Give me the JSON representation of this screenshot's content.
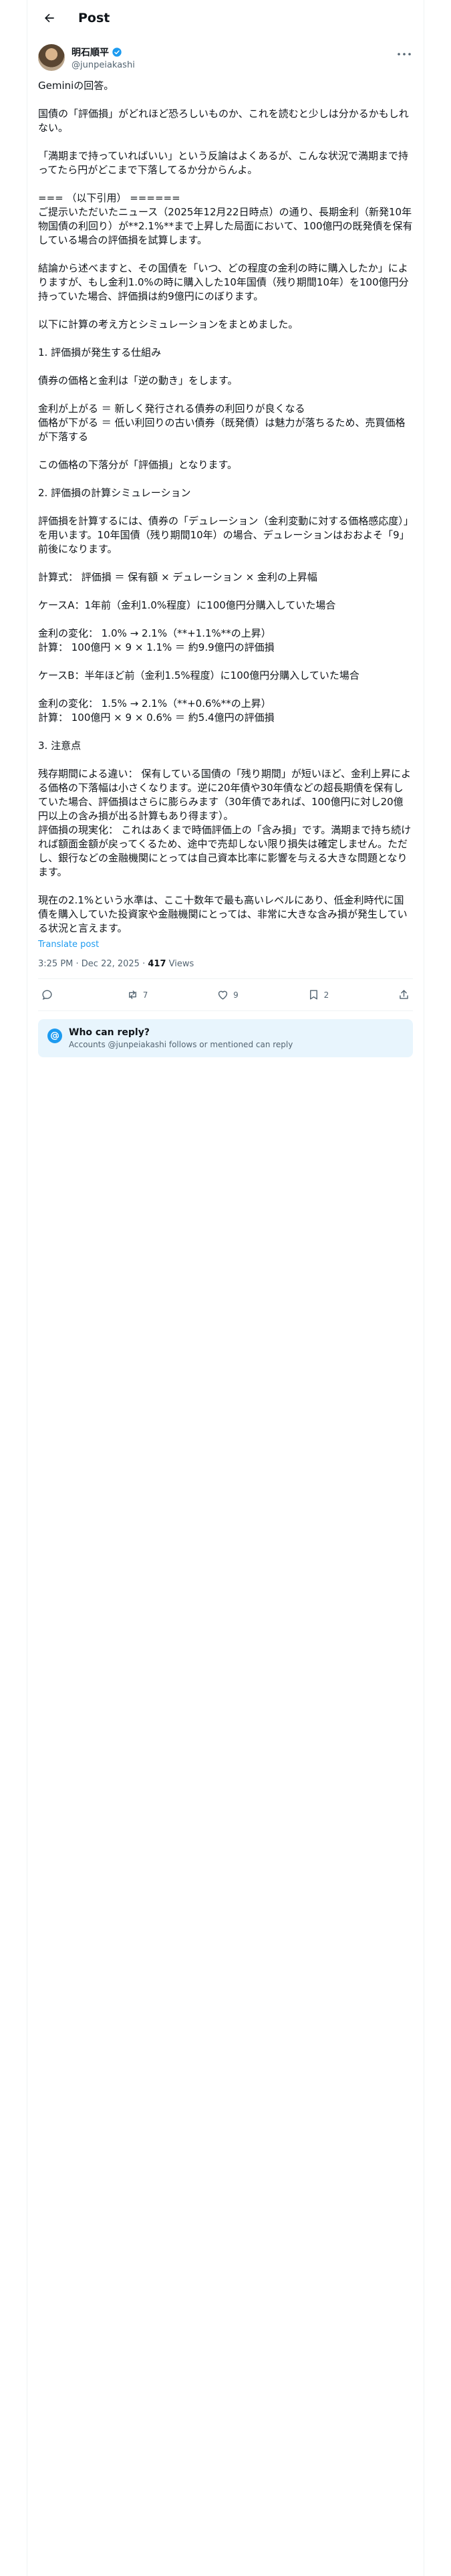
{
  "header": {
    "title": "Post"
  },
  "author": {
    "display_name": "明石順平",
    "handle": "@junpeiakashi"
  },
  "post": {
    "paragraphs": [
      "Geminiの回答。",
      "国債の「評価損」がどれほど恐ろしいものか、これを読むと少しは分かるかもしれない。",
      "「満期まで持っていればいい」という反論はよくあるが、こんな状況で満期まで持ってたら円がどこまで下落してるか分からんよ。",
      "=== （以下引用） ======\nご提示いただいたニュース（2025年12月22日時点）の通り、長期金利（新発10年物国債の利回り）が**2.1%**まで上昇した局面において、100億円の既発債を保有している場合の評価損を試算します。",
      "結論から述べますと、その国債を「いつ、どの程度の金利の時に購入したか」によりますが、もし金利1.0%の時に購入した10年国債（残り期間10年）を100億円分持っていた場合、評価損は約9億円にのぼります。",
      "以下に計算の考え方とシミュレーションをまとめました。",
      "1. 評価損が発生する仕組み",
      "債券の価格と金利は「逆の動き」をします。",
      "金利が上がる ＝ 新しく発行される債券の利回りが良くなる\n価格が下がる ＝ 低い利回りの古い債券（既発債）は魅力が落ちるため、売買価格が下落する",
      "この価格の下落分が「評価損」となります。",
      "2. 評価損の計算シミュレーション",
      "評価損を計算するには、債券の「デュレーション（金利変動に対する価格感応度）」を用います。10年国債（残り期間10年）の場合、デュレーションはおおよそ「9」前後になります。",
      "計算式： 評価損 ＝ 保有額 × デュレーション × 金利の上昇幅",
      "ケースA：1年前（金利1.0%程度）に100億円分購入していた場合",
      "金利の変化： 1.0% → 2.1%（**+1.1%**の上昇）\n計算： 100億円 × 9 × 1.1% ＝ 約9.9億円の評価損",
      "ケースB：半年ほど前（金利1.5%程度）に100億円分購入していた場合",
      "金利の変化： 1.5% → 2.1%（**+0.6%**の上昇）\n計算： 100億円 × 9 × 0.6% ＝ 約5.4億円の評価損",
      "3. 注意点",
      "残存期間による違い： 保有している国債の「残り期間」が短いほど、金利上昇による価格の下落幅は小さくなります。逆に20年債や30年債などの超長期債を保有していた場合、評価損はさらに膨らみます（30年債であれば、100億円に対し20億円以上の含み損が出る計算もあり得ます）。\n評価損の現実化： これはあくまで時価評価上の「含み損」です。満期まで持ち続ければ額面金額が戻ってくるため、途中で売却しない限り損失は確定しません。ただし、銀行などの金融機関にとっては自己資本比率に影響を与える大きな問題となります。",
      "現在の2.1%という水準は、ここ十数年で最も高いレベルにあり、低金利時代に国債を購入していた投資家や金融機関にとっては、非常に大きな含み損が発生している状況と言えます。"
    ],
    "translate_label": "Translate post",
    "time": "3:25 PM · Dec 22, 2025 · ",
    "views_count": "417",
    "views_label": " Views"
  },
  "actions": {
    "reply_count": "",
    "repost_count": "7",
    "like_count": "9",
    "bookmark_count": "2"
  },
  "reply_info": {
    "title": "Who can reply?",
    "subtitle": "Accounts @junpeiakashi follows or mentioned can reply"
  },
  "colors": {
    "accent": "#1d9bf0",
    "secondary_text": "#536471",
    "panel_bg": "#e8f5fd"
  }
}
